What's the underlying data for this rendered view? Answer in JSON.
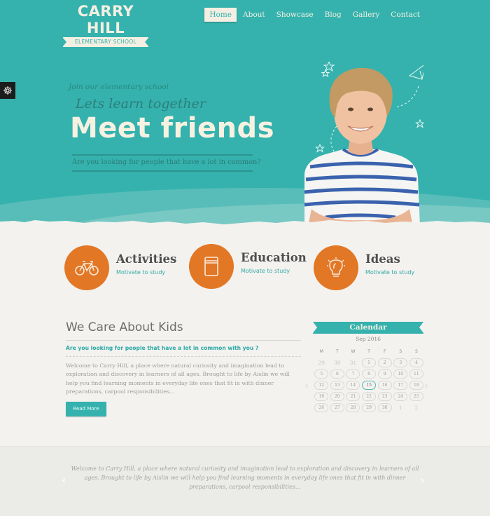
{
  "brand": {
    "title": "CARRY HILL",
    "subtitle": "ELEMENTARY SCHOOL",
    "accent_color": "#35b2ad",
    "orange_color": "#e27726"
  },
  "nav": {
    "items": [
      {
        "label": "Home",
        "active": true
      },
      {
        "label": "About",
        "active": false
      },
      {
        "label": "Showcase",
        "active": false
      },
      {
        "label": "Blog",
        "active": false
      },
      {
        "label": "Gallery",
        "active": false
      },
      {
        "label": "Contact",
        "active": false
      }
    ]
  },
  "settings": {
    "icon": "gear-icon"
  },
  "hero": {
    "kicker": "Join our elementary school",
    "tagline": "Lets learn together",
    "headline": "Meet friends",
    "question": "Are you looking for people that have a lot in common?"
  },
  "features": [
    {
      "title": "Activities",
      "subtitle": "Motivate to study",
      "icon": "bicycle-icon"
    },
    {
      "title": "Education",
      "subtitle": "Motivate to study",
      "icon": "book-icon"
    },
    {
      "title": "Ideas",
      "subtitle": "Motivate to study",
      "icon": "lightbulb-icon"
    }
  ],
  "about": {
    "title": "We Care About Kids",
    "subtitle": "Are you looking for people that have a lot in common with you ?",
    "body": "Welcome to Carry Hill, a place where natural curiosity and imagination lead to exploration and discovery in learners of all ages. Brought to life by Aislin we will help you find learning moments in everyday life ones that fit in with dinner preparations, carpool responsibilities…",
    "button_label": "Read More"
  },
  "calendar": {
    "title": "Calendar",
    "month": "Sep 2016",
    "weekdays": [
      "M",
      "T",
      "W",
      "T",
      "F",
      "S",
      "S"
    ],
    "today": "15",
    "weeks": [
      [
        {
          "d": "29",
          "muted": true
        },
        {
          "d": "30",
          "muted": true
        },
        {
          "d": "31",
          "muted": true
        },
        {
          "d": "1"
        },
        {
          "d": "2"
        },
        {
          "d": "3"
        },
        {
          "d": "4"
        }
      ],
      [
        {
          "d": "5"
        },
        {
          "d": "6"
        },
        {
          "d": "7"
        },
        {
          "d": "8"
        },
        {
          "d": "9"
        },
        {
          "d": "10"
        },
        {
          "d": "11"
        }
      ],
      [
        {
          "d": "12"
        },
        {
          "d": "13"
        },
        {
          "d": "14"
        },
        {
          "d": "15"
        },
        {
          "d": "16"
        },
        {
          "d": "17"
        },
        {
          "d": "18"
        }
      ],
      [
        {
          "d": "19"
        },
        {
          "d": "20"
        },
        {
          "d": "21"
        },
        {
          "d": "22"
        },
        {
          "d": "23"
        },
        {
          "d": "24"
        },
        {
          "d": "25"
        }
      ],
      [
        {
          "d": "26"
        },
        {
          "d": "27"
        },
        {
          "d": "28"
        },
        {
          "d": "29"
        },
        {
          "d": "30"
        },
        {
          "d": "1",
          "muted": true
        },
        {
          "d": "2",
          "muted": true
        }
      ]
    ],
    "prev_glyph": "‹",
    "next_glyph": "›"
  },
  "testimonial": {
    "text": "Welcome to Carry Hill, a place where natural curiosity and imagination lead to exploration and discovery in learners of all ages. Brought to life by Aislin we will help you find learning moments in everyday life ones that fit in with dinner preparations, carpool responsibilities…",
    "prev_glyph": "‹",
    "next_glyph": "›"
  }
}
